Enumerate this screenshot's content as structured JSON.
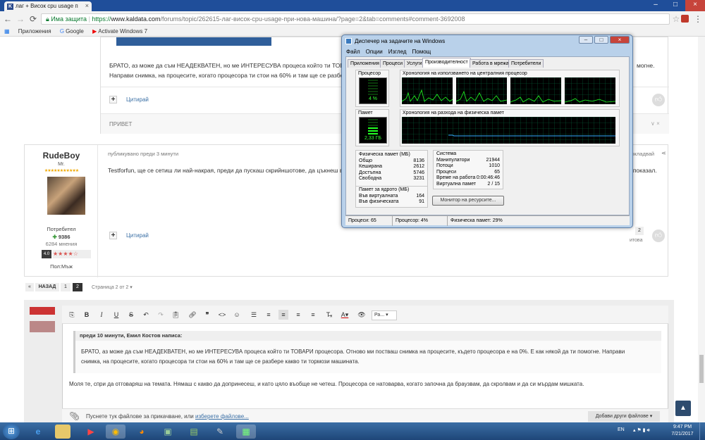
{
  "browser": {
    "tab_title": "лаг + Висок cpu usage п",
    "address_secure": "Има защита",
    "url_prefix": "https://",
    "url_domain": "www.kaldata.com",
    "url_path": "/forums/topic/262615-лаг-висок-cpu-usage-при-нова-машина/?page=2&tab=comments#comment-3692008",
    "bookmarks": [
      "Приложения",
      "Google",
      "Activate Windows 7"
    ]
  },
  "post1": {
    "text_line1": "БРАТО, аз може да съм НЕАДЕКВАТЕН, но ме ИНТЕРЕСУВА процеса който ти ТОВАРИ",
    "text_line1_tail": "могне.",
    "text_line2": "Направи снимка, на процесите, когато процесора ти стои на 60% и там ще се разбере",
    "quote_label": "Цитирай",
    "bottom_label": "ПРИВЕТ"
  },
  "post2": {
    "author": "RudeBoy",
    "rank": "Mr.",
    "meta": "публикувано преди 3 минути",
    "share_label": "докладвай",
    "text_line": "Testforfun, ще се сетиш ли най-накрая, преди да пускаш скрийншотове, да цъкнеш въ",
    "text_tail": "ки показал.",
    "quote_label": "Цитирай",
    "group": "Потребител",
    "points": "9386",
    "posts": "6284 мнения",
    "rating": "4.0",
    "gender": "Пол:Мъж",
    "reaction_count": "2",
    "reaction_label": "итова"
  },
  "pagination": {
    "back": "НАЗАД",
    "pages": [
      "1",
      "2"
    ],
    "info": "Страница 2 от 2"
  },
  "editor": {
    "format_select": "Ра...",
    "quote_header": "преди 10 минути, Емил Костов написа:",
    "quote_line1": "БРАТО, аз може да съм НЕАДЕКВАТЕН, но ме ИНТЕРЕСУВА процеса който ти ТОВАРИ процесора. Отново ми постваш снимка на процесите, където процесора е на 0%. Е как някой да ти помогне. Направи",
    "quote_line2": "снимка, на процесите, когато процесора ти стои на 60% и там ще се разбере какво ти тормози машината.",
    "reply_text": "Моля те, спри да отговаряш на темата. Нямаш с какво да допринесеш, и като цяло въобще не четеш. Процесора се натоварва, когато започна да браузвам, да скролвам и да си мърдам мишката.",
    "attach_text": "Пуснете тук файлове за прикачване, или ",
    "attach_link": "изберете файлове...",
    "more_files": "Добави други файлове"
  },
  "taskmgr": {
    "title": "Диспечер на задачите на Windows",
    "menu": [
      "Файл",
      "Опции",
      "Изглед",
      "Помощ"
    ],
    "tabs": [
      "Приложения",
      "Процеси",
      "Услуги",
      "Производителност",
      "Работа в мрежа",
      "Потребители"
    ],
    "cpu_label": "Процесор",
    "cpu_value": "4 %",
    "cpu_history_label": "Хронология на използването на централния процесор",
    "mem_label": "Памет",
    "mem_value": "2,33 ГБ",
    "mem_history_label": "Хронология на разхода на физическа памет",
    "phys_title": "Физическа памет (МБ)",
    "phys": [
      [
        "Общо",
        "8136"
      ],
      [
        "Кеширана",
        "2612"
      ],
      [
        "Достъпна",
        "5746"
      ],
      [
        "Свободна",
        "3231"
      ]
    ],
    "kernel_title": "Памет за ядрото (МБ)",
    "kernel": [
      [
        "Във виртуалната",
        "164"
      ],
      [
        "Във физическата",
        "91"
      ]
    ],
    "system_title": "Система",
    "system": [
      [
        "Манипулатори",
        "21944"
      ],
      [
        "Потоци",
        "1010"
      ],
      [
        "Процеси",
        "65"
      ],
      [
        "Време на работа",
        "0:00:46:46"
      ],
      [
        "Виртуална памет",
        "2 / 15"
      ]
    ],
    "monitor_button": "Монитор на ресурсите...",
    "status_procs": "Процеси: 65",
    "status_cpu": "Процесор: 4%",
    "status_mem": "Физическа памет: 29%"
  },
  "taskbar": {
    "lang": "EN",
    "time": "9:47 PM",
    "date": "7/21/2017"
  }
}
